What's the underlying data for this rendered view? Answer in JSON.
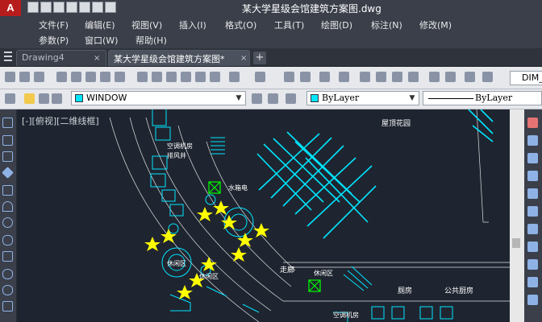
{
  "window": {
    "logo": "A",
    "title": "某大学星级会馆建筑方案图.dwg"
  },
  "menu": {
    "items": [
      "文件(F)",
      "编辑(E)",
      "视图(V)",
      "插入(I)",
      "格式(O)",
      "工具(T)",
      "绘图(D)",
      "标注(N)",
      "修改(M)"
    ],
    "items_row2": [
      "参数(P)",
      "窗口(W)",
      "帮助(H)"
    ]
  },
  "tabs": [
    {
      "label": "Drawing4",
      "active": false
    },
    {
      "label": "某大学星级会馆建筑方案图*",
      "active": true
    }
  ],
  "tab_close": "×",
  "new_tab": "+",
  "toolbar": {
    "dimstyle_value": "DIM_"
  },
  "layer": {
    "name": "WINDOW",
    "color": "#00e5ff"
  },
  "properties": {
    "color": "ByLayer",
    "linetype": "ByLayer"
  },
  "viewport": {
    "label": "[-][俯视][二维线框]"
  },
  "drawing_labels": [
    "屋顶花园",
    "空调机房",
    "排风井",
    "水箱电",
    "休闲区",
    "休闲区",
    "走廊",
    "休闲区",
    "空调机房",
    "厕房",
    "公共厨房"
  ],
  "colors": {
    "canvas_bg": "#1f2530",
    "cyan": "#00e5ff",
    "yellow": "#ffff00",
    "green": "#00ff00",
    "white": "#ffffff"
  }
}
